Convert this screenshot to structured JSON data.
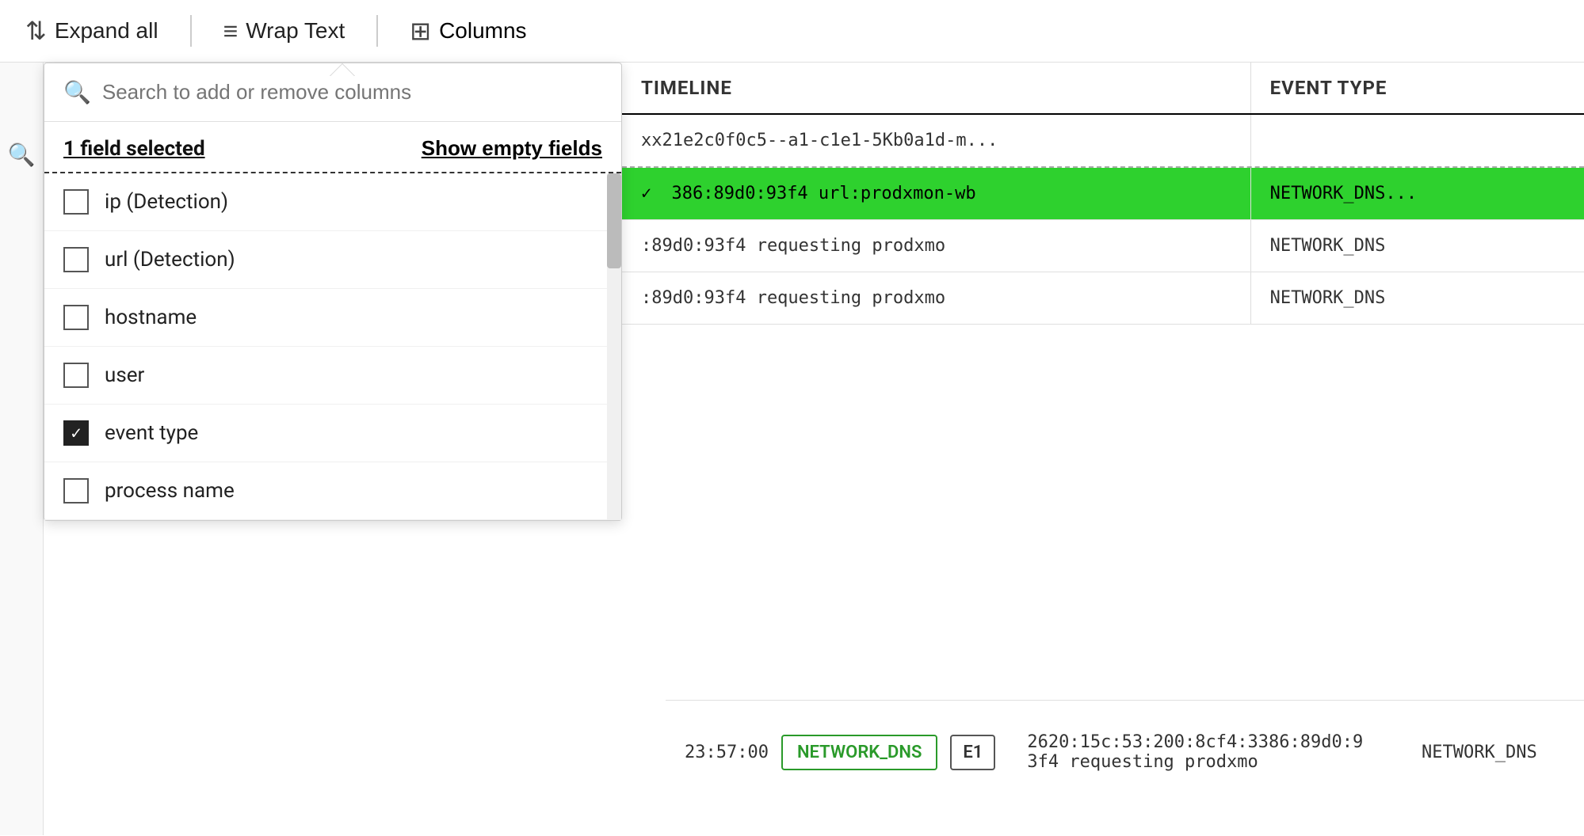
{
  "toolbar": {
    "expand_all": "Expand all",
    "wrap_text": "Wrap Text",
    "columns": "Columns"
  },
  "dropdown": {
    "search_placeholder": "Search to add or remove columns",
    "field_selected_label": "1 field selected",
    "show_empty_fields": "Show empty fields",
    "fields": [
      {
        "id": "ip",
        "label": "ip (Detection)",
        "checked": false
      },
      {
        "id": "url",
        "label": "url (Detection)",
        "checked": false
      },
      {
        "id": "hostname",
        "label": "hostname",
        "checked": false
      },
      {
        "id": "user",
        "label": "user",
        "checked": false
      },
      {
        "id": "event_type",
        "label": "event type",
        "checked": true
      },
      {
        "id": "process_name",
        "label": "process name",
        "checked": false
      }
    ]
  },
  "table": {
    "col_timeline": "TIMELINE",
    "col_event_type": "EVENT TYPE",
    "rows": [
      {
        "timeline": "xx21e2c0f0c5--a1-c1e1-5Kb0a1d-m...",
        "event_type": "",
        "highlighted": false,
        "dashed": true
      },
      {
        "timeline": "386:89d0:93f4 url:prodxmon-wb",
        "event_type": "NETWORK_DNS...",
        "highlighted": true,
        "dashed": false
      },
      {
        "timeline": ":89d0:93f4 requesting prodxmo",
        "event_type": "NETWORK_DNS",
        "highlighted": false,
        "dashed": false
      },
      {
        "timeline": ":89d0:93f4 requesting prodxmo",
        "event_type": "NETWORK_DNS",
        "highlighted": false,
        "dashed": false
      }
    ]
  },
  "bottom": {
    "timestamp": "23:57:00",
    "timeline_text": "2620:15c:53:200:8cf4:3386:89d0:93f4 requesting prodxmo",
    "event_type": "NETWORK_DNS",
    "badge_dns": "NETWORK_DNS",
    "badge_e1": "E1"
  }
}
